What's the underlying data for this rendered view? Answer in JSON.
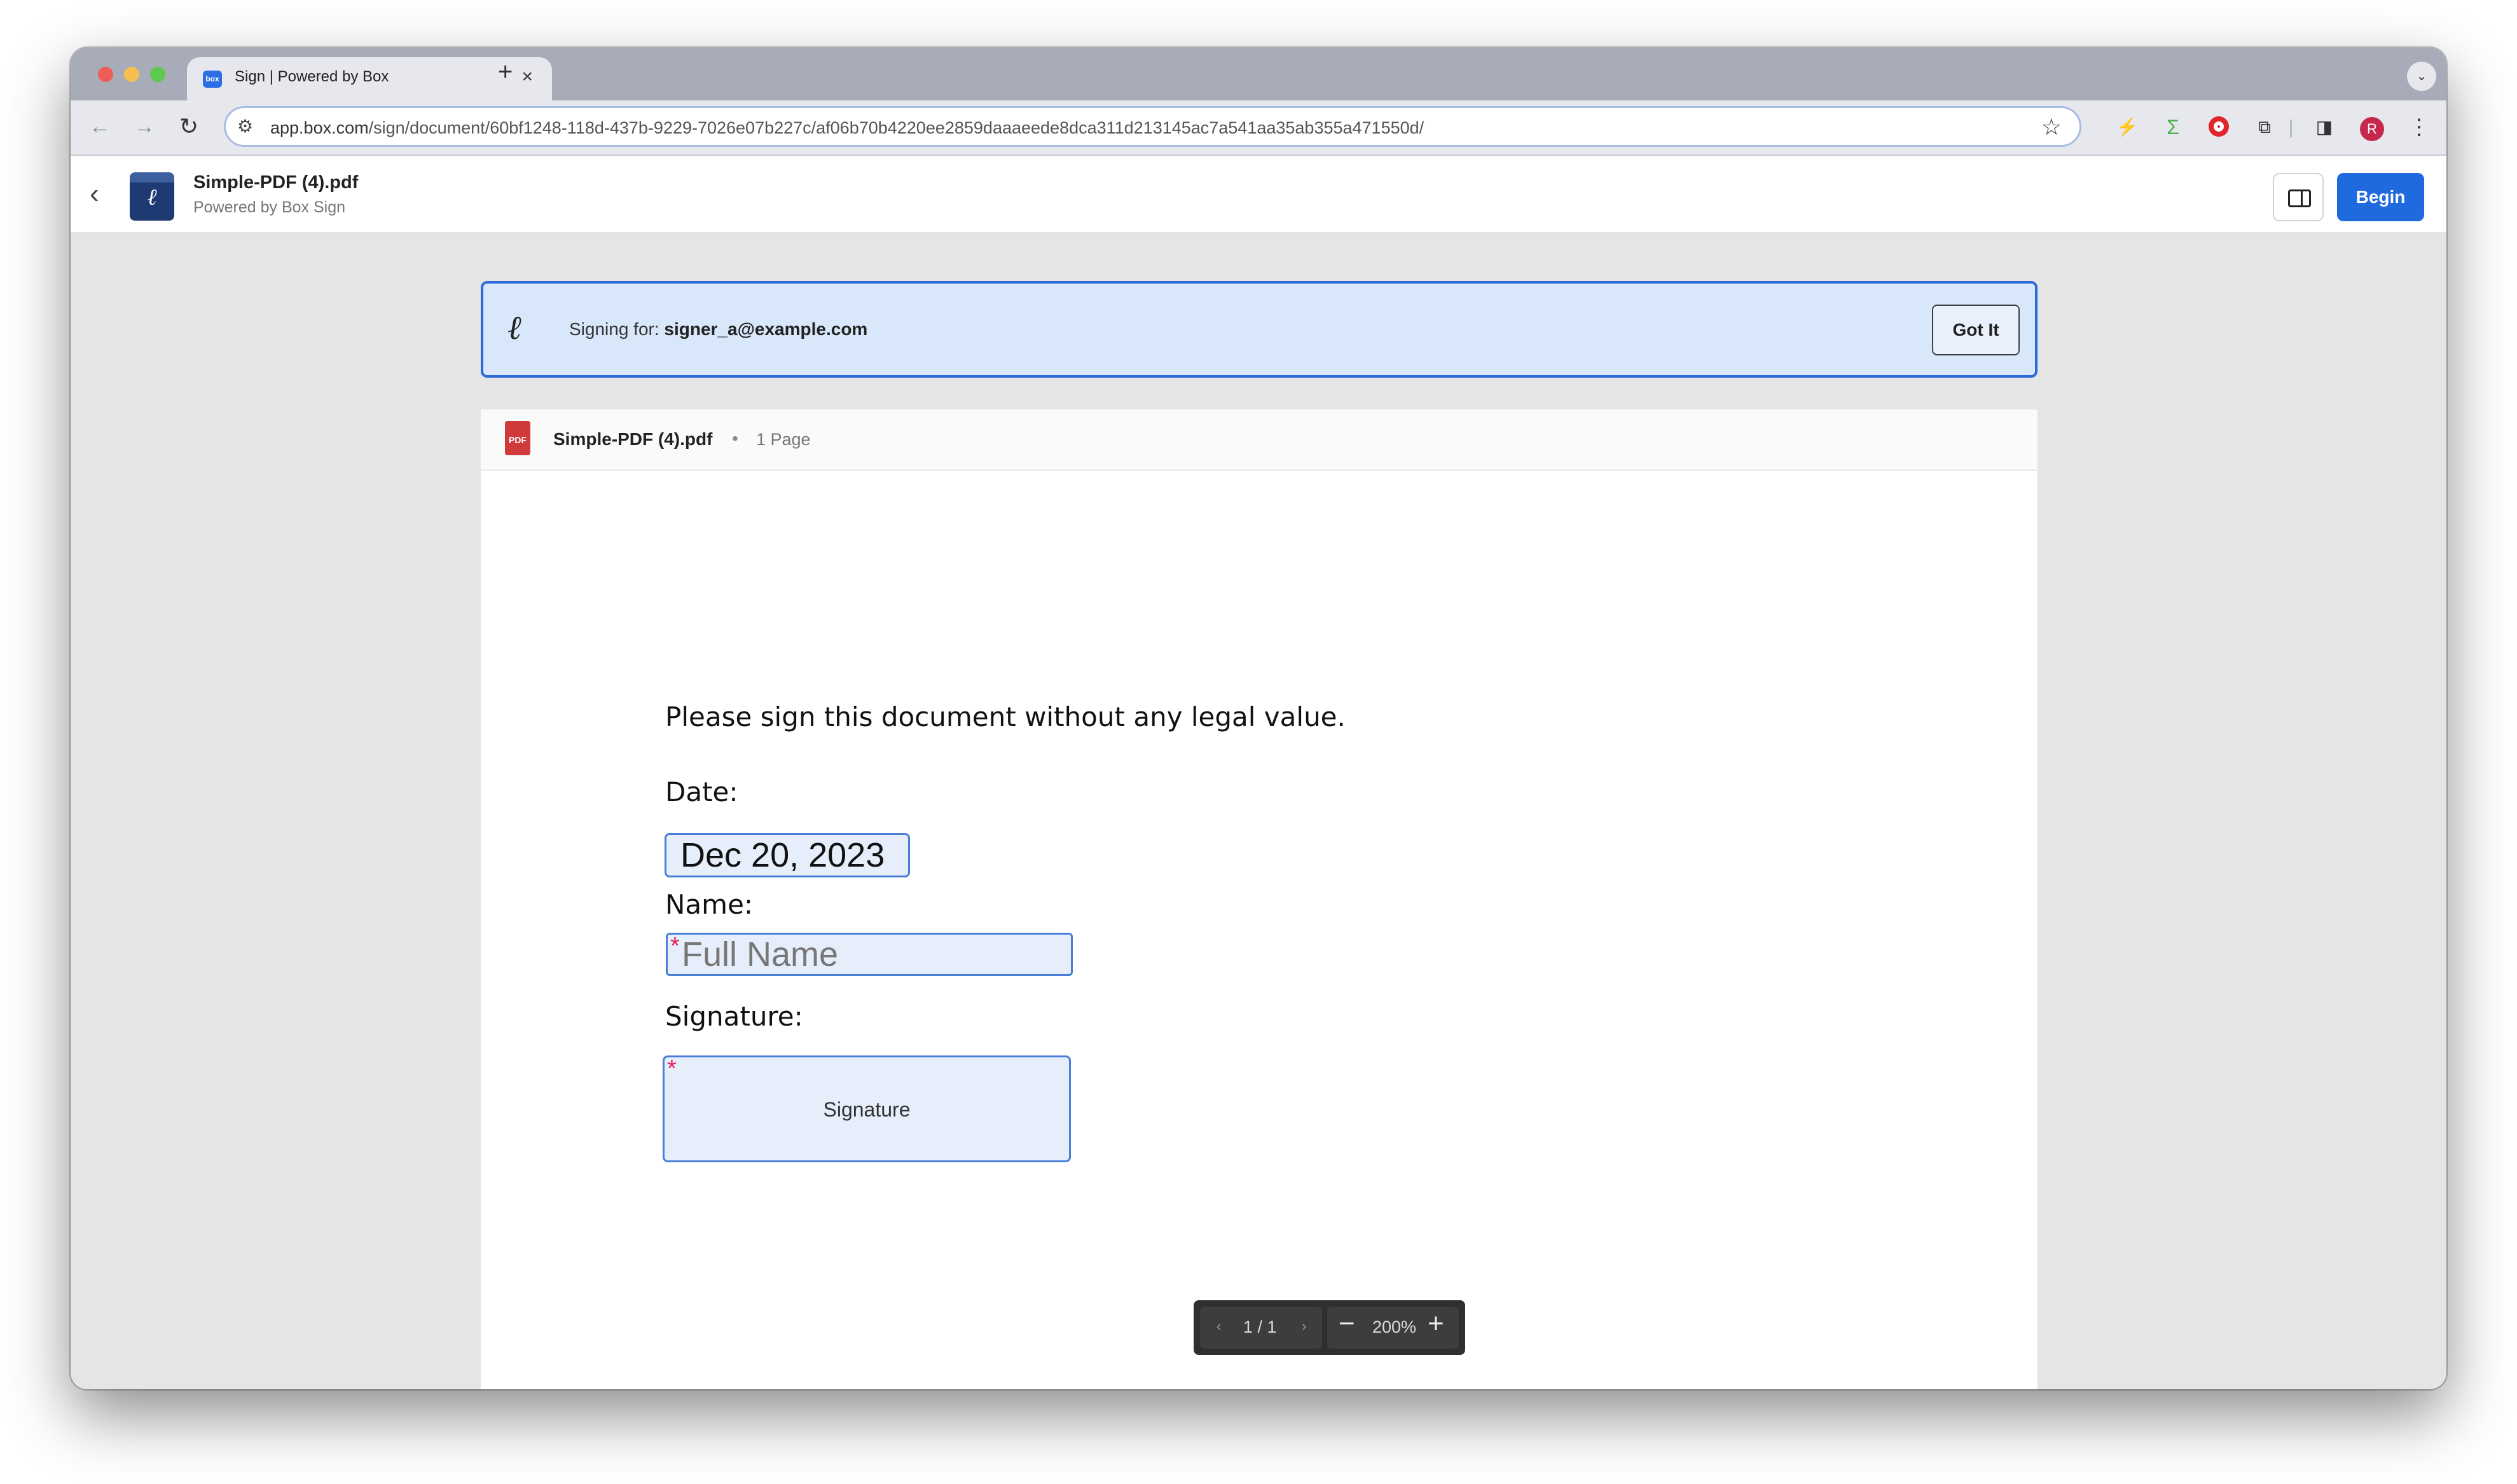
{
  "browser": {
    "tab": {
      "favicon_text": "box",
      "title": "Sign | Powered by Box",
      "close": "×"
    },
    "new_tab": "+",
    "url_domain": "app.box.com",
    "url_path": "/sign/document/60bf1248-118d-437b-9229-7026e07b227c/af06b70b4220ee2859daaaeede8dca311d213145ac7a541aa35ab355a471550d/",
    "avatar_initial": "R"
  },
  "app_header": {
    "title": "Simple-PDF (4).pdf",
    "subtitle": "Powered by Box Sign",
    "begin_label": "Begin"
  },
  "banner": {
    "label": "Signing for: ",
    "email": "signer_a@example.com",
    "got_it_label": "Got It"
  },
  "document": {
    "filename": "Simple-PDF (4).pdf",
    "separator": "•",
    "pages_label": "1 Page",
    "pdf_icon_text": "PDF",
    "instruction": "Please sign this document without any legal value.",
    "date_label": "Date:",
    "date_value": "Dec 20, 2023",
    "name_label": "Name:",
    "name_placeholder": "Full Name",
    "signature_label": "Signature:",
    "signature_field_text": "Signature",
    "required_marker": "*"
  },
  "pager": {
    "prev": "‹",
    "page_count": "1 / 1",
    "next": "›",
    "zoom_out": "−",
    "zoom": "200%",
    "zoom_in": "+"
  },
  "colors": {
    "accent": "#1f6adf",
    "banner_bg": "#d9e7fb",
    "field_border": "#4a7fd8",
    "required": "#e0265a"
  }
}
